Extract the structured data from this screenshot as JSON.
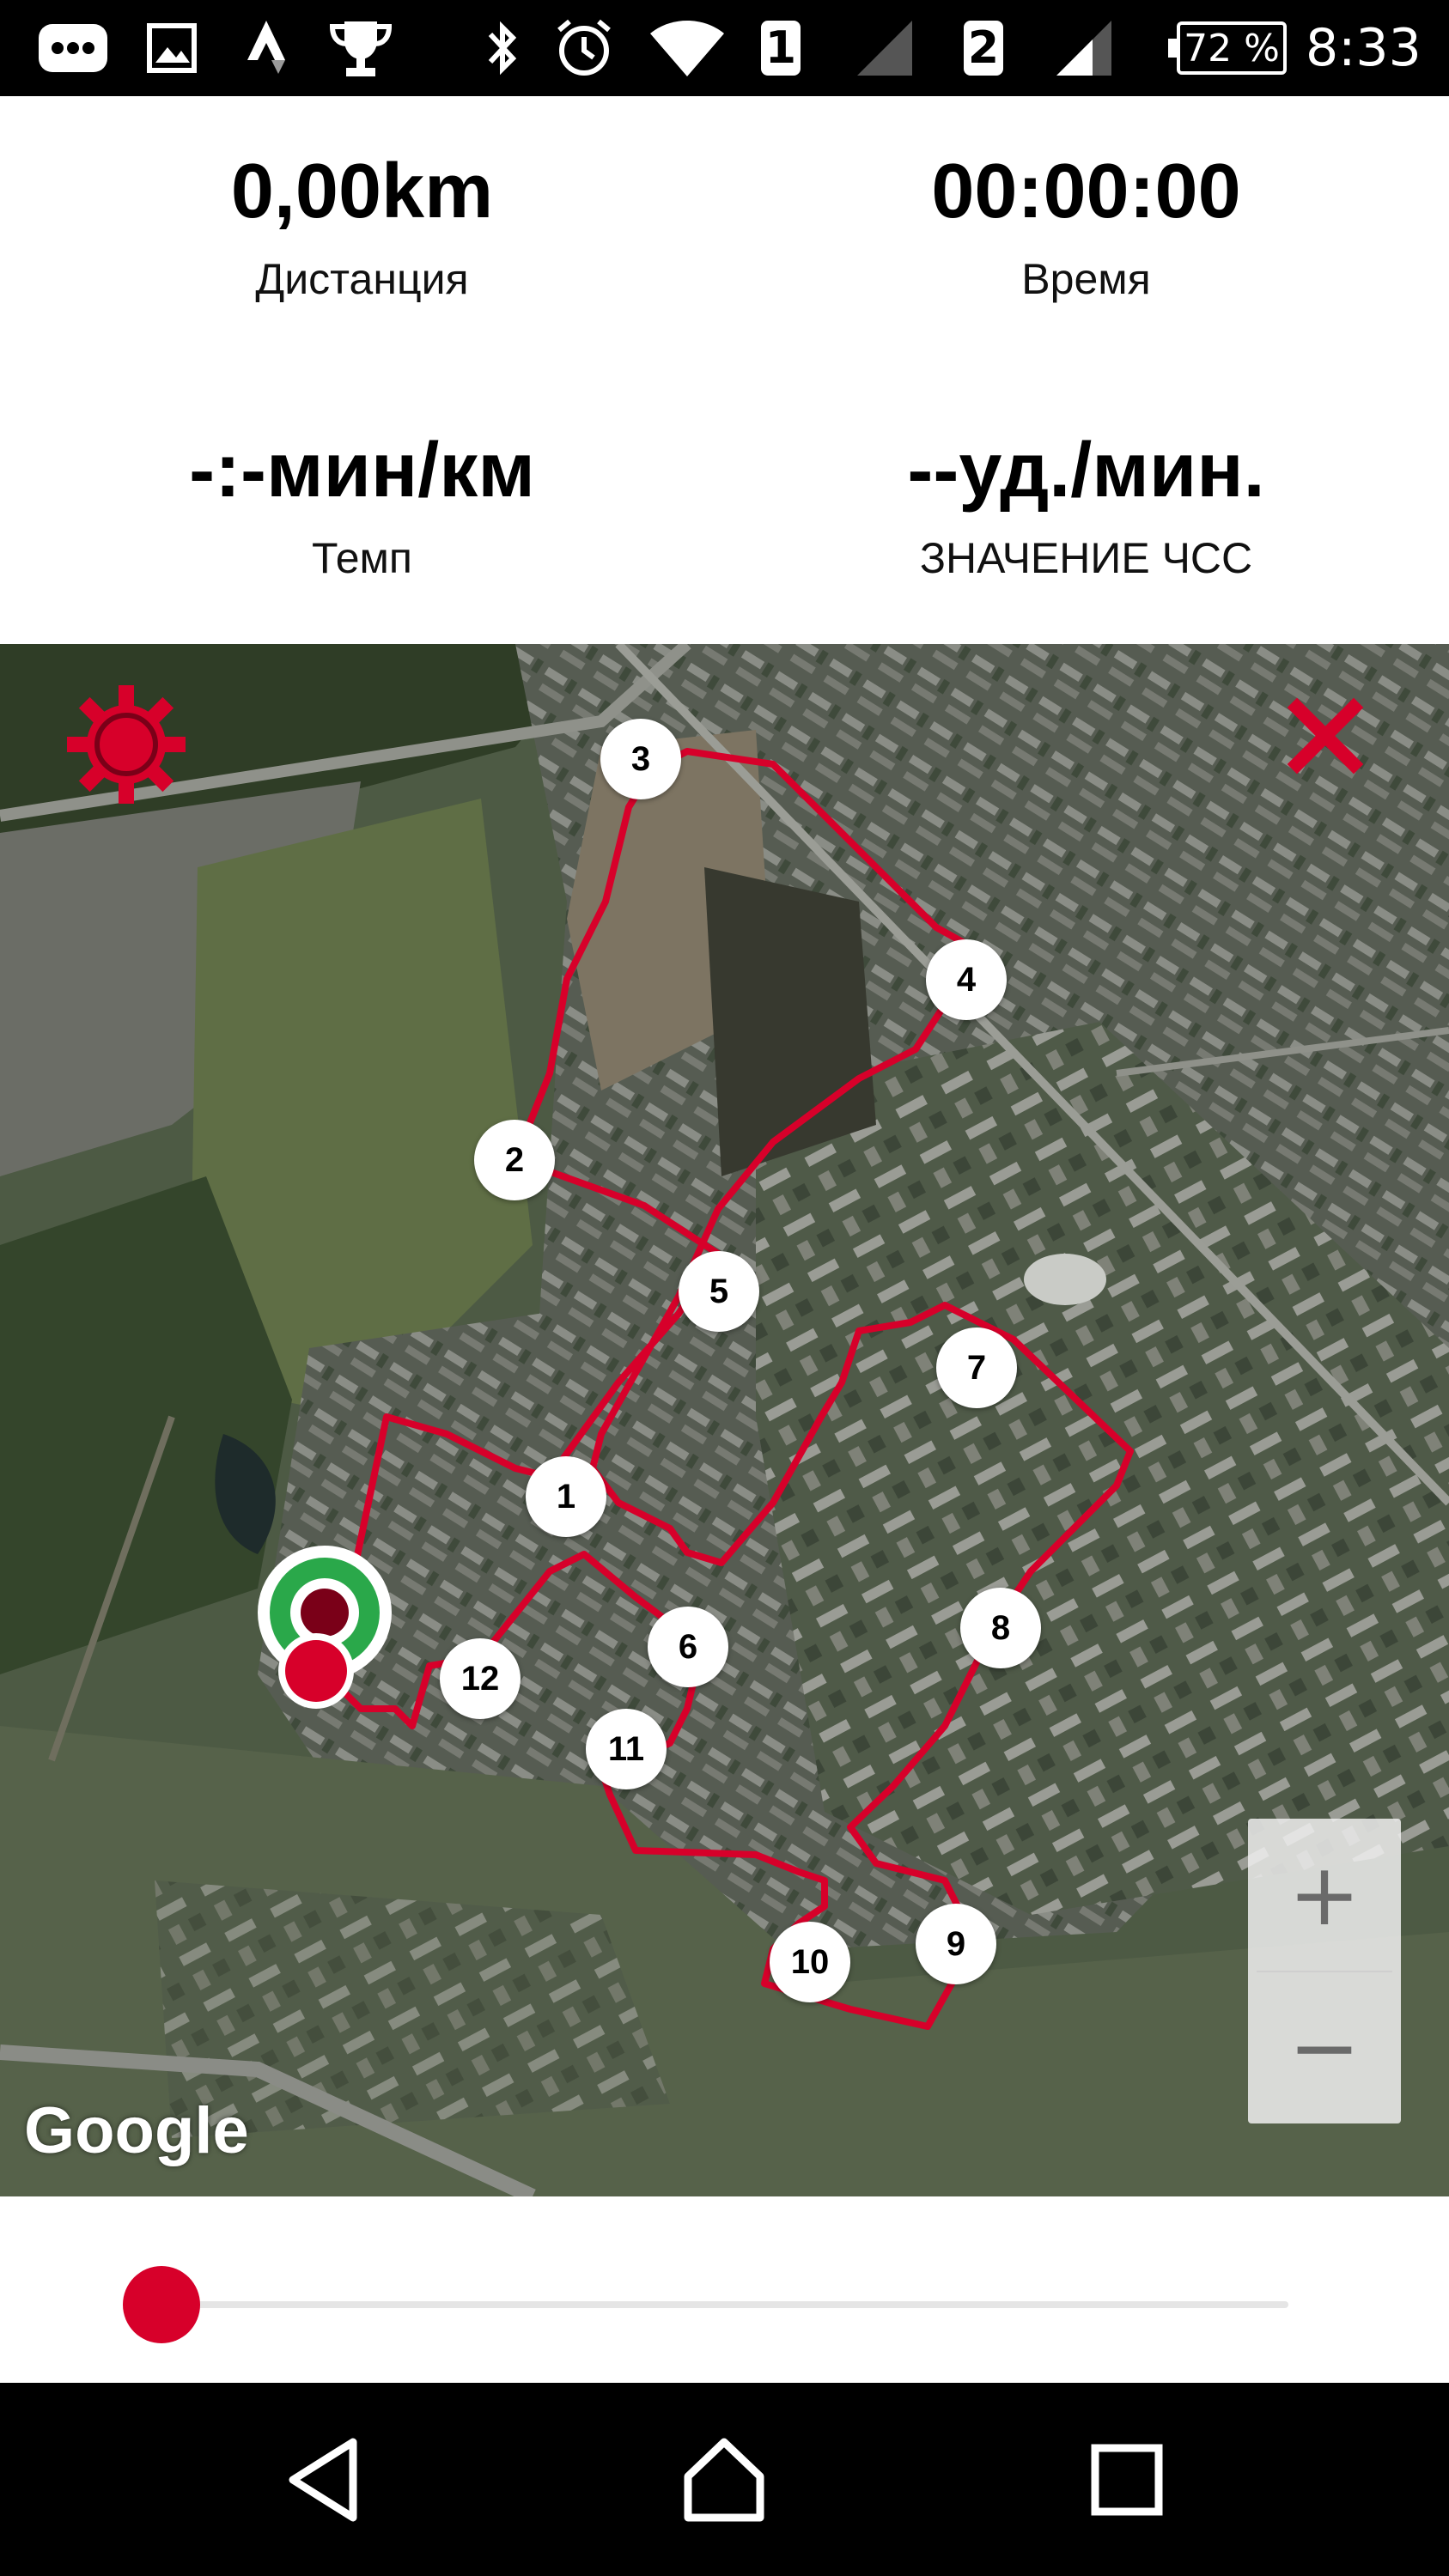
{
  "status_bar": {
    "battery_percent": "72 %",
    "time": "8:33",
    "sim1": "1",
    "sim2": "2",
    "icons": [
      "more-notifications-icon",
      "image-icon",
      "strava-icon",
      "trophy-icon",
      "bluetooth-icon",
      "alarm-icon",
      "wifi-icon",
      "signal-icon",
      "signal-icon",
      "battery-icon"
    ]
  },
  "stats": {
    "distance": {
      "value": "0,00km",
      "label": "Дистанция"
    },
    "time": {
      "value": "00:00:00",
      "label": "Время"
    },
    "pace": {
      "value": "-:-мин/км",
      "label": "Темп"
    },
    "heart_rate": {
      "value": "--уд./мин.",
      "label": "ЗНАЧЕНИЕ ЧСС"
    }
  },
  "map": {
    "attribution": "Google",
    "route_color": "#d7002a",
    "waypoints": [
      "1",
      "2",
      "3",
      "4",
      "5",
      "6",
      "7",
      "8",
      "9",
      "10",
      "11",
      "12"
    ],
    "zoom_in_label": "+",
    "zoom_out_label": "−",
    "settings_icon": "gear-icon",
    "close_icon": "close-icon"
  },
  "slider": {
    "progress": 0
  },
  "nav_bar": {
    "buttons": [
      "back-icon",
      "home-icon",
      "recents-icon"
    ]
  },
  "colors": {
    "accent": "#d7002a",
    "start_marker": "#2aa84a"
  }
}
